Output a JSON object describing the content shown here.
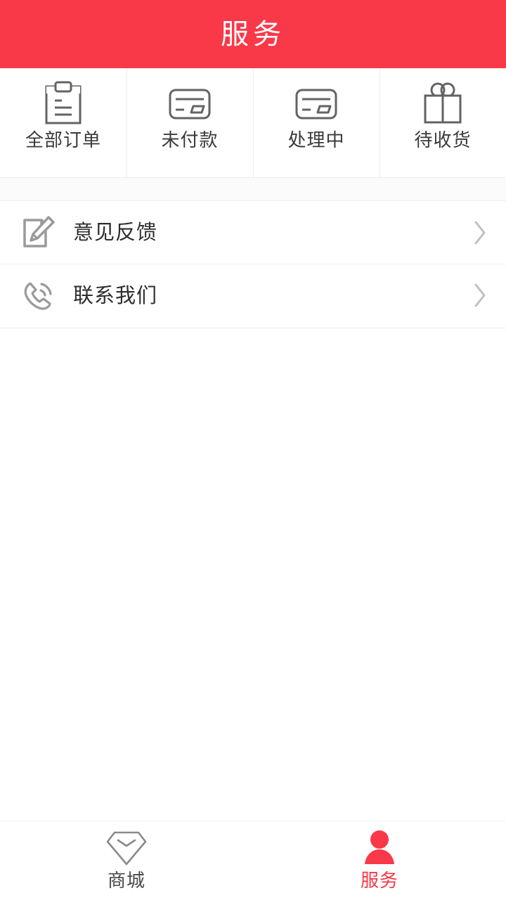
{
  "theme": {
    "brand_red": "#F93848",
    "header_text": "#FFFFFF",
    "icon_gray": "#616161",
    "label_dark": "#3A3A3A",
    "divider": "#ECECEC",
    "page_bg": "#FBFBFB",
    "card_bg": "#FFFFFF",
    "tab_inactive": "#4A4A4A",
    "tab_active": "#F93848"
  },
  "header": {
    "title": "服务"
  },
  "order_grid": {
    "items": [
      {
        "label": "全部订单",
        "icon": "clipboard-icon"
      },
      {
        "label": "未付款",
        "icon": "credit-card-icon"
      },
      {
        "label": "处理中",
        "icon": "credit-card-icon"
      },
      {
        "label": "待收货",
        "icon": "gift-box-icon"
      }
    ]
  },
  "service_list": {
    "items": [
      {
        "label": "意见反馈",
        "icon": "edit-document-icon",
        "chevron": "chevron-right-icon"
      },
      {
        "label": "联系我们",
        "icon": "phone-call-icon",
        "chevron": "chevron-right-icon"
      }
    ]
  },
  "tabbar": {
    "items": [
      {
        "label": "商城",
        "icon": "diamond-icon",
        "active": false
      },
      {
        "label": "服务",
        "icon": "user-person-icon",
        "active": true
      }
    ]
  }
}
